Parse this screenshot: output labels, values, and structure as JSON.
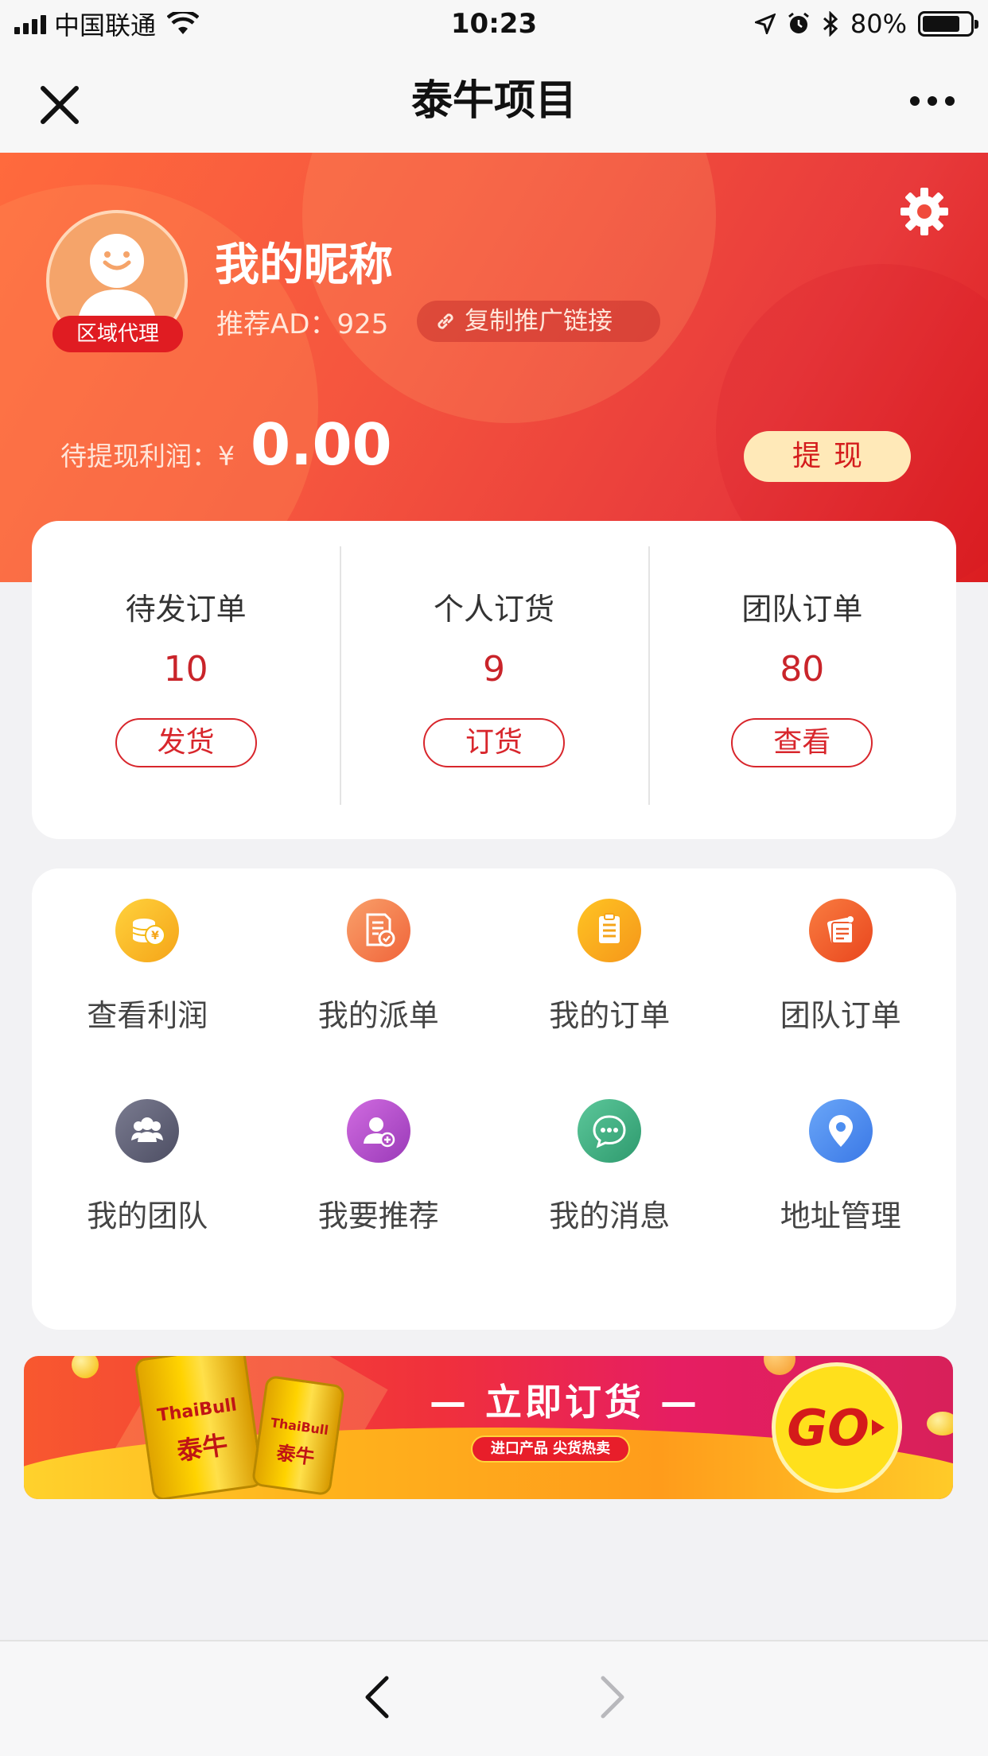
{
  "status_bar": {
    "carrier": "中国联通",
    "time": "10:23",
    "battery": "80%",
    "battery_level": 0.8
  },
  "header": {
    "title": "泰牛项目"
  },
  "profile": {
    "nickname": "我的昵称",
    "role_badge": "区域代理",
    "referral": "推荐AD：925",
    "copy_link_label": "复制推广链接",
    "profit_label": "待提现利润：",
    "currency": "¥",
    "profit_value": "0.00",
    "withdraw_label": "提现"
  },
  "stats": [
    {
      "label": "待发订单",
      "value": "10",
      "action": "发货"
    },
    {
      "label": "个人订货",
      "value": "9",
      "action": "订货"
    },
    {
      "label": "团队订单",
      "value": "80",
      "action": "查看"
    }
  ],
  "menu": [
    {
      "label": "查看利润",
      "icon": "coins-icon",
      "color": "#f5b914"
    },
    {
      "label": "我的派单",
      "icon": "dispatch-icon",
      "color": "#f5784a"
    },
    {
      "label": "我的订单",
      "icon": "clipboard-icon",
      "color": "#f5a418"
    },
    {
      "label": "团队订单",
      "icon": "team-order-icon",
      "color": "#f06230"
    },
    {
      "label": "我的团队",
      "icon": "group-icon",
      "color": "#5c5d73"
    },
    {
      "label": "我要推荐",
      "icon": "add-user-icon",
      "color": "#b24ec6"
    },
    {
      "label": "我的消息",
      "icon": "message-icon",
      "color": "#3fb084"
    },
    {
      "label": "地址管理",
      "icon": "location-pin-icon",
      "color": "#4c8ef0"
    }
  ],
  "banner": {
    "title": "— 立即订货 —",
    "subtitle": "进口产品 尖货热卖",
    "go": "GO",
    "can_brand": "ThaiBull",
    "can_name": "泰牛"
  }
}
